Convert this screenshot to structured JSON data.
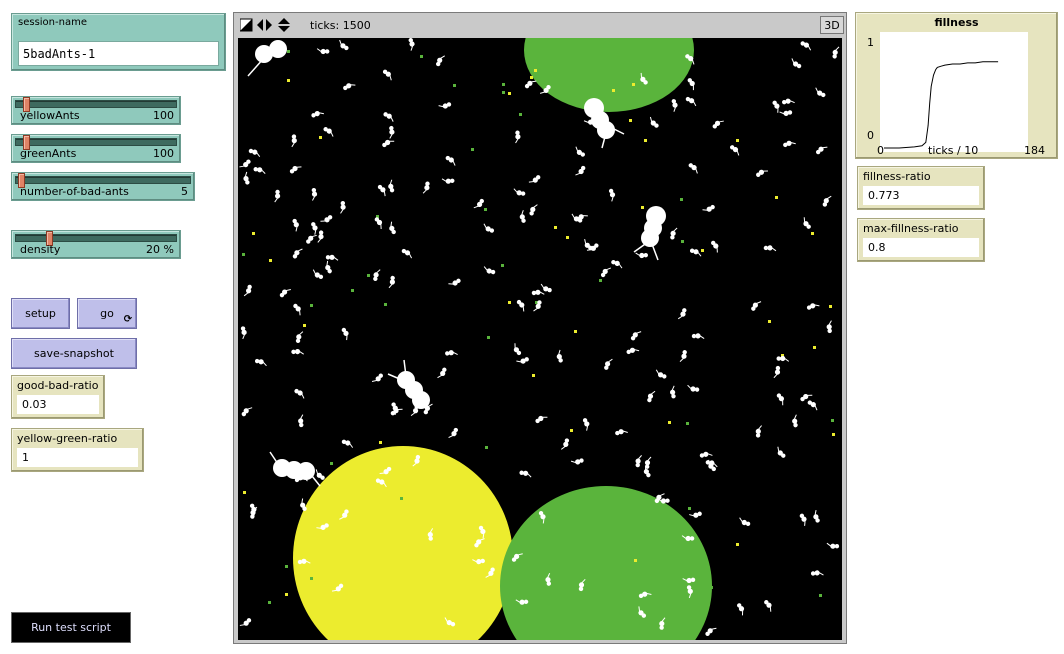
{
  "session": {
    "label": "session-name",
    "value": "5badAnts-1"
  },
  "sliders": [
    {
      "name": "yellowAnts",
      "value": "100",
      "fraction": 0.05
    },
    {
      "name": "greenAnts",
      "value": "100",
      "fraction": 0.05
    },
    {
      "name": "number-of-bad-ants",
      "value": "5",
      "fraction": 0.02
    },
    {
      "name": "density",
      "value": "20 %",
      "fraction": 0.2
    }
  ],
  "buttons": {
    "setup": "setup",
    "go": "go",
    "go_forever_icon": "⟳",
    "save_snapshot": "save-snapshot",
    "run_test_script": "Run test script"
  },
  "monitors": {
    "good_bad_ratio": {
      "label": "good-bad-ratio",
      "value": "0.03"
    },
    "yellow_green_ratio": {
      "label": "yellow-green-ratio",
      "value": "1"
    },
    "fillness_ratio": {
      "label": "fillness-ratio",
      "value": "0.773"
    },
    "max_fillness_ratio": {
      "label": "max-fillness-ratio",
      "value": "0.8"
    }
  },
  "view": {
    "ticks_label": "ticks: 1500",
    "button_3d": "3D",
    "colors": {
      "background": "#000000",
      "yellow": "#ecec2e",
      "green": "#5ab43c",
      "ant": "#ffffff"
    }
  },
  "plot": {
    "title": "fillness",
    "xlabel": "ticks / 10",
    "ymin_label": "0",
    "ymax_label": "1",
    "xmin_label": "0",
    "xmax_label": "184"
  },
  "chart_data": {
    "type": "line",
    "title": "fillness",
    "xlabel": "ticks / 10",
    "ylabel": "",
    "xlim": [
      0,
      184
    ],
    "ylim": [
      0,
      1
    ],
    "x": [
      0,
      20,
      40,
      50,
      55,
      58,
      60,
      62,
      65,
      68,
      70,
      75,
      80,
      90,
      100,
      110,
      120,
      130,
      140,
      150
    ],
    "y": [
      0.0,
      0.0,
      0.01,
      0.02,
      0.05,
      0.2,
      0.4,
      0.55,
      0.65,
      0.7,
      0.72,
      0.73,
      0.74,
      0.75,
      0.75,
      0.76,
      0.76,
      0.77,
      0.77,
      0.77
    ]
  }
}
